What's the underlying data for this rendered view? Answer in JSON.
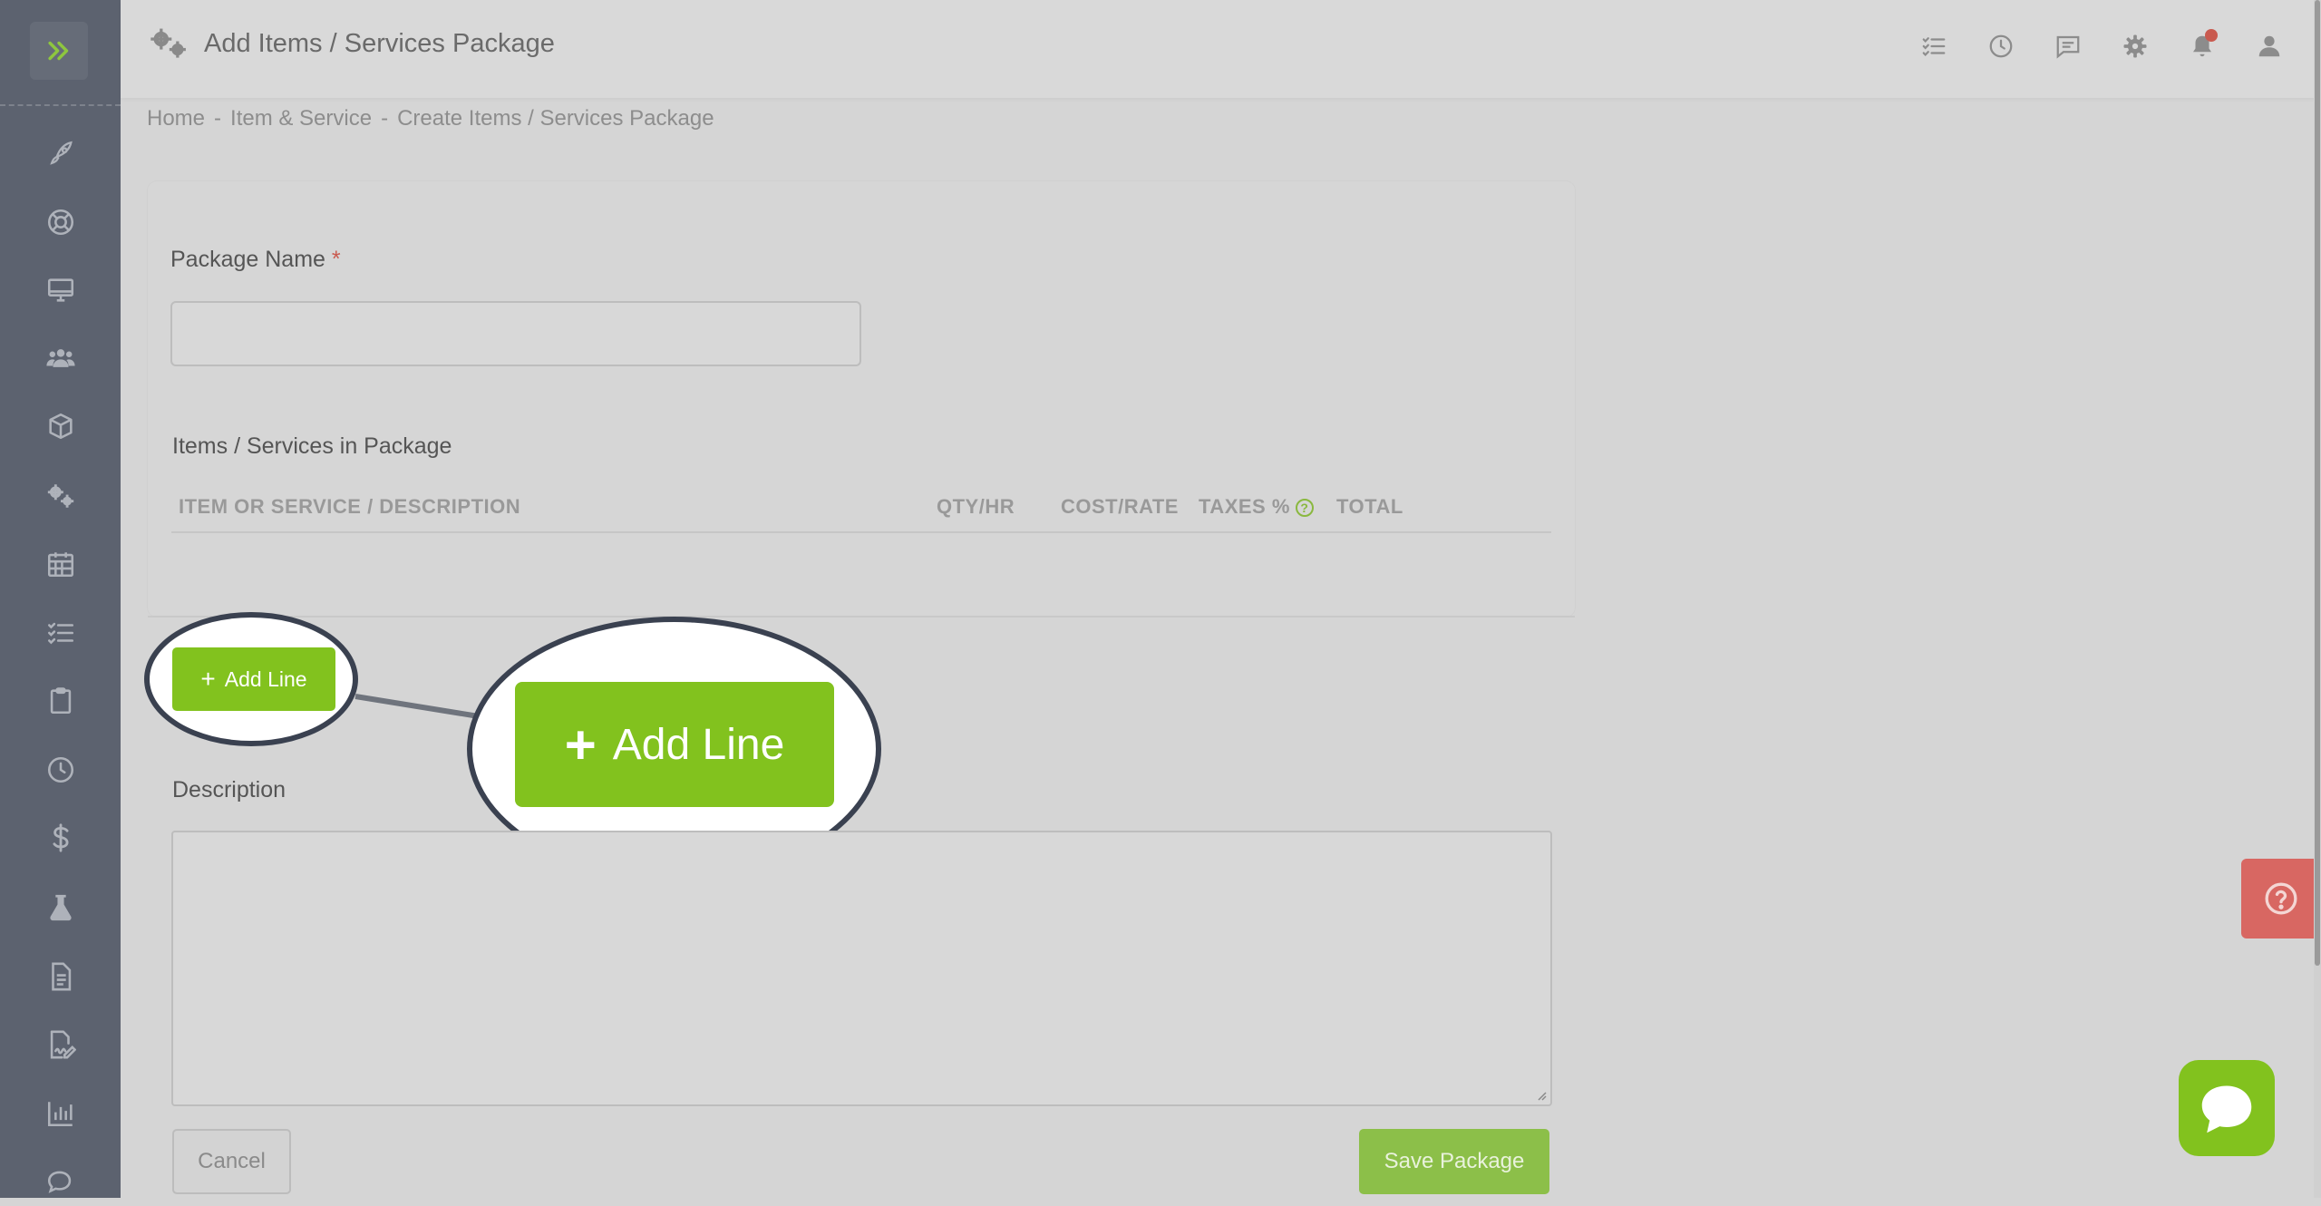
{
  "header": {
    "title": "Add Items / Services Package",
    "title_icon": "gears-icon",
    "icons": [
      "checklist-icon",
      "clock-icon",
      "chat-icon",
      "settings-gear-icon",
      "bell-icon",
      "user-icon"
    ]
  },
  "breadcrumb": {
    "items": [
      "Home",
      "Item & Service",
      "Create Items / Services Package"
    ],
    "separator": "-"
  },
  "sidebar": {
    "toggle_icon": "double-chevron-right-icon",
    "items": [
      "rocket-icon",
      "lifebuoy-icon",
      "monitor-icon",
      "users-icon",
      "box-icon",
      "gears-icon",
      "calendar-icon",
      "checklist-icon",
      "clipboard-icon",
      "clock-icon",
      "dollar-icon",
      "flask-icon",
      "document-icon",
      "signature-icon",
      "bar-chart-icon",
      "chat-icon"
    ]
  },
  "form": {
    "package_name_label": "Package Name",
    "required_mark": "*",
    "package_name_value": "",
    "items_section_label": "Items / Services in Package",
    "columns": [
      "ITEM OR SERVICE / DESCRIPTION",
      "QTY/HR",
      "COST/RATE",
      "TAXES %",
      "TOTAL"
    ],
    "taxes_help": "?",
    "add_line_label": "Add Line",
    "add_line_plus": "+",
    "description_label": "Description",
    "description_value": "",
    "cancel_label": "Cancel",
    "save_label": "Save Package"
  },
  "callout": {
    "zoom_label": "Add Line",
    "zoom_plus": "+"
  },
  "widgets": {
    "help_tab_icon": "question-circle-icon",
    "chat_icon": "chat-bubble-icon"
  },
  "colors": {
    "sidebar_bg": "#5c626f",
    "accent_green": "#82c21e",
    "danger_red": "#d86762",
    "callout_border": "#3a4150"
  }
}
